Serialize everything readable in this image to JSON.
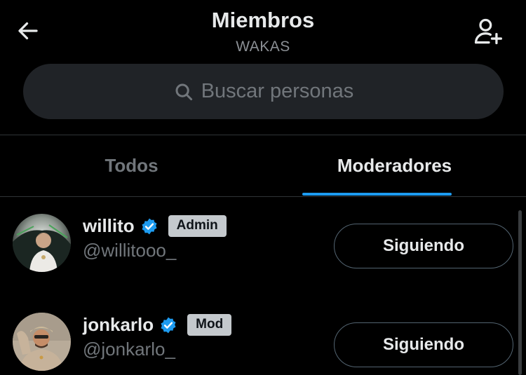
{
  "header": {
    "title": "Miembros",
    "subtitle": "WAKAS",
    "back_icon": "arrow-left-icon",
    "add_member_icon": "person-add-icon"
  },
  "search": {
    "placeholder": "Buscar personas",
    "icon": "search-icon"
  },
  "tabs": [
    {
      "label": "Todos",
      "active": false
    },
    {
      "label": "Moderadores",
      "active": true
    }
  ],
  "members": [
    {
      "name": "willito",
      "verified": true,
      "role": "Admin",
      "handle": "@willitooo_",
      "button": "Siguiendo"
    },
    {
      "name": "jonkarlo",
      "verified": true,
      "role": "Mod",
      "handle": "@jonkarlo_",
      "button": "Siguiendo"
    }
  ],
  "colors": {
    "background": "#000000",
    "accent": "#1d9bf0",
    "verified": "#1d9bf0",
    "badge": "#c4c9cd",
    "search_bg": "#202327",
    "secondary_text": "#71767b"
  }
}
